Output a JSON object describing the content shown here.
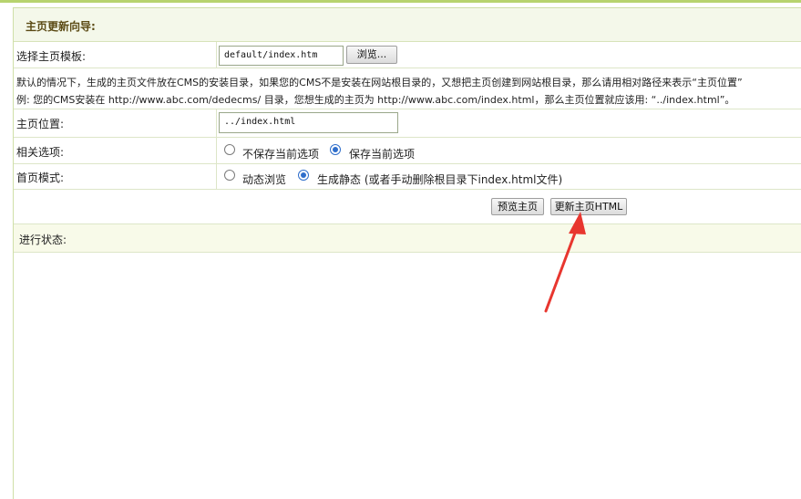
{
  "wizard": {
    "title": "主页更新向导:"
  },
  "template_row": {
    "label": "选择主页模板:",
    "value": "default/index.htm",
    "browse_label": "浏览..."
  },
  "note": {
    "line1": "默认的情况下，生成的主页文件放在CMS的安装目录，如果您的CMS不是安装在网站根目录的，又想把主页创建到网站根目录，那么请用相对路径来表示“主页位置”",
    "line2": "例: 您的CMS安装在 http://www.abc.com/dedecms/ 目录，您想生成的主页为 http://www.abc.com/index.html，那么主页位置就应该用: “../index.html”。"
  },
  "position_row": {
    "label": "主页位置:",
    "value": "../index.html"
  },
  "options_row": {
    "label": "相关选项:",
    "option1": "不保存当前选项",
    "option2": "保存当前选项",
    "selected": "保存当前选项"
  },
  "mode_row": {
    "label": "首页模式:",
    "option1": "动态浏览",
    "option2": "生成静态 (或者手动删除根目录下index.html文件)",
    "selected": "生成静态"
  },
  "actions": {
    "preview_label": "预览主页",
    "update_label": "更新主页HTML"
  },
  "status": {
    "label": "进行状态:"
  },
  "colors": {
    "title_bg": "#f4f8ea",
    "title_text": "#5b4a14",
    "arrow": "#e8362f",
    "radio_selected": "#2f6ecb"
  }
}
